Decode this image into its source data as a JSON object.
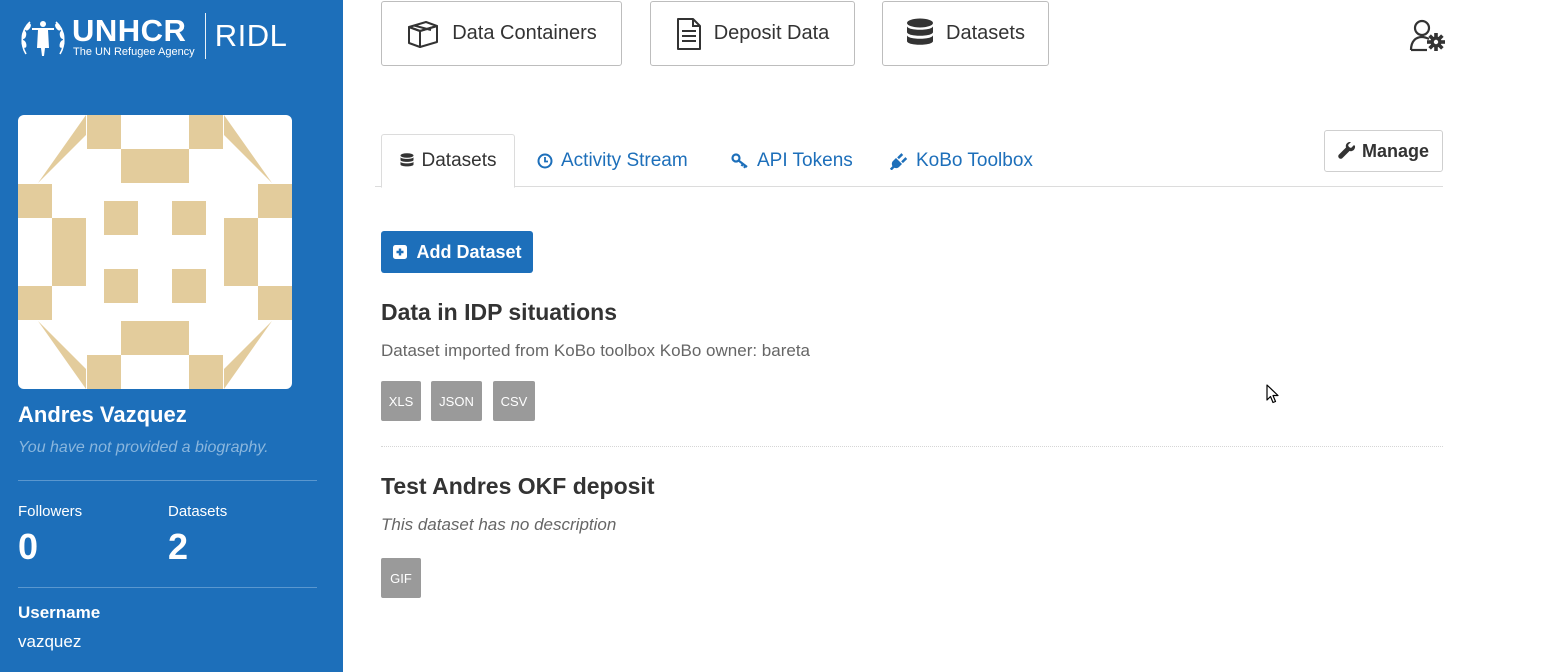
{
  "brand": {
    "org": "UNHCR",
    "tagline": "The UN Refugee Agency",
    "app": "RIDL"
  },
  "top_nav": [
    {
      "label": "Data Containers",
      "icon": "box-icon"
    },
    {
      "label": "Deposit Data",
      "icon": "document-icon"
    },
    {
      "label": "Datasets",
      "icon": "database-icon"
    }
  ],
  "profile": {
    "name": "Andres Vazquez",
    "bio": "You have not provided a biography.",
    "followers_label": "Followers",
    "followers": "0",
    "datasets_label": "Datasets",
    "datasets": "2",
    "username_label": "Username",
    "username": "vazquez",
    "avatar_color": "#e3cc9c"
  },
  "tabs": [
    {
      "label": "Datasets",
      "icon": "database-icon",
      "active": true
    },
    {
      "label": "Activity Stream",
      "icon": "clock-icon",
      "active": false
    },
    {
      "label": "API Tokens",
      "icon": "key-icon",
      "active": false
    },
    {
      "label": "KoBo Toolbox",
      "icon": "plug-icon",
      "active": false
    }
  ],
  "manage_label": "Manage",
  "add_dataset_label": "Add Dataset",
  "datasets": [
    {
      "title": "Data in IDP situations",
      "description": "Dataset imported from KoBo toolbox KoBo owner: bareta",
      "formats": [
        "XLS",
        "JSON",
        "CSV"
      ]
    },
    {
      "title": "Test Andres OKF deposit",
      "description": "This dataset has no description",
      "formats": [
        "GIF"
      ]
    }
  ],
  "colors": {
    "brand_blue": "#1d6fba",
    "format_badge": "#9a9a9a"
  }
}
